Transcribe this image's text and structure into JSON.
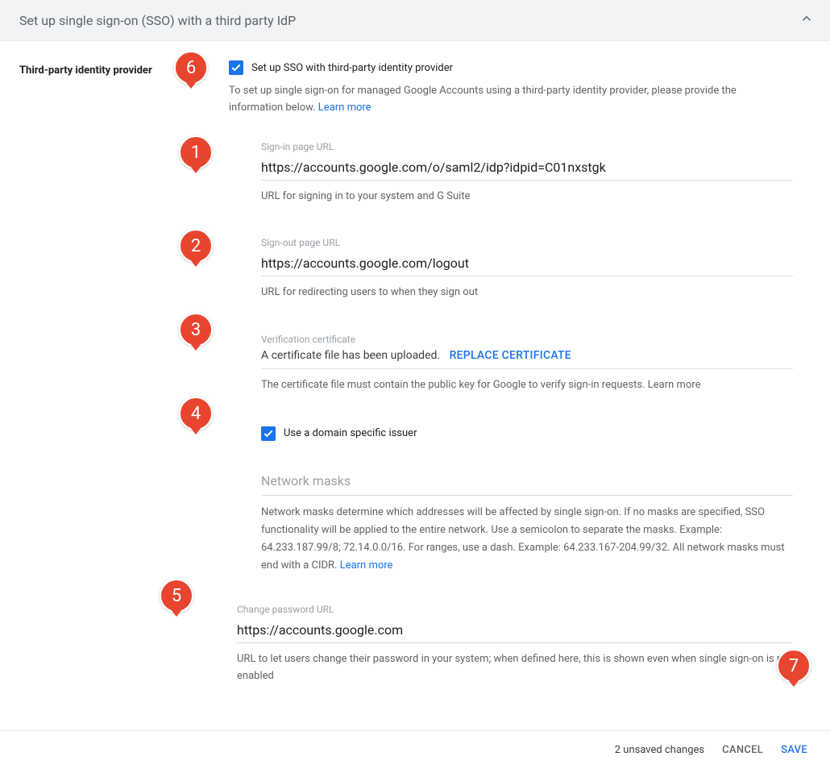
{
  "header": {
    "title": "Set up single sign-on (SSO) with a third party IdP"
  },
  "side_label": "Third-party identity provider",
  "setup_checkbox_label": "Set up SSO with third-party identity provider",
  "setup_helper": "To set up single sign-on for managed Google Accounts using a third-party identity provider, please provide the information below. ",
  "learn_more": "Learn more",
  "signin": {
    "label": "Sign-in page URL",
    "value": "https://accounts.google.com/o/saml2/idp?idpid=C01nxstgk",
    "hint": "URL for signing in to your system and G Suite"
  },
  "signout": {
    "label": "Sign-out page URL",
    "value": "https://accounts.google.com/logout",
    "hint": "URL for redirecting users to when they sign out"
  },
  "cert": {
    "label": "Verification certificate",
    "uploaded_text": "A certificate file has been uploaded.",
    "replace": "REPLACE CERTIFICATE",
    "hint_prefix": "The certificate file must contain the public key for Google to verify sign-in requests. "
  },
  "domain_issuer_label": "Use a domain specific issuer",
  "masks": {
    "title": "Network masks",
    "body_prefix": "Network masks determine which addresses will be affected by single sign-on. If no masks are specified, SSO functionality will be applied to the entire network. Use a semicolon to separate the masks. Example: 64.233.187.99/8; 72.14.0.0/16. For ranges, use a dash. Example: 64.233.167-204.99/32. All network masks must end with a CIDR. "
  },
  "password": {
    "label": "Change password URL",
    "value": "https://accounts.google.com",
    "hint": "URL to let users change their password in your system; when defined here, this is shown even when single sign-on is not enabled"
  },
  "footer": {
    "status": "2 unsaved changes",
    "cancel": "CANCEL",
    "save": "SAVE"
  },
  "badges": {
    "b1": "1",
    "b2": "2",
    "b3": "3",
    "b4": "4",
    "b5": "5",
    "b6": "6",
    "b7": "7"
  }
}
